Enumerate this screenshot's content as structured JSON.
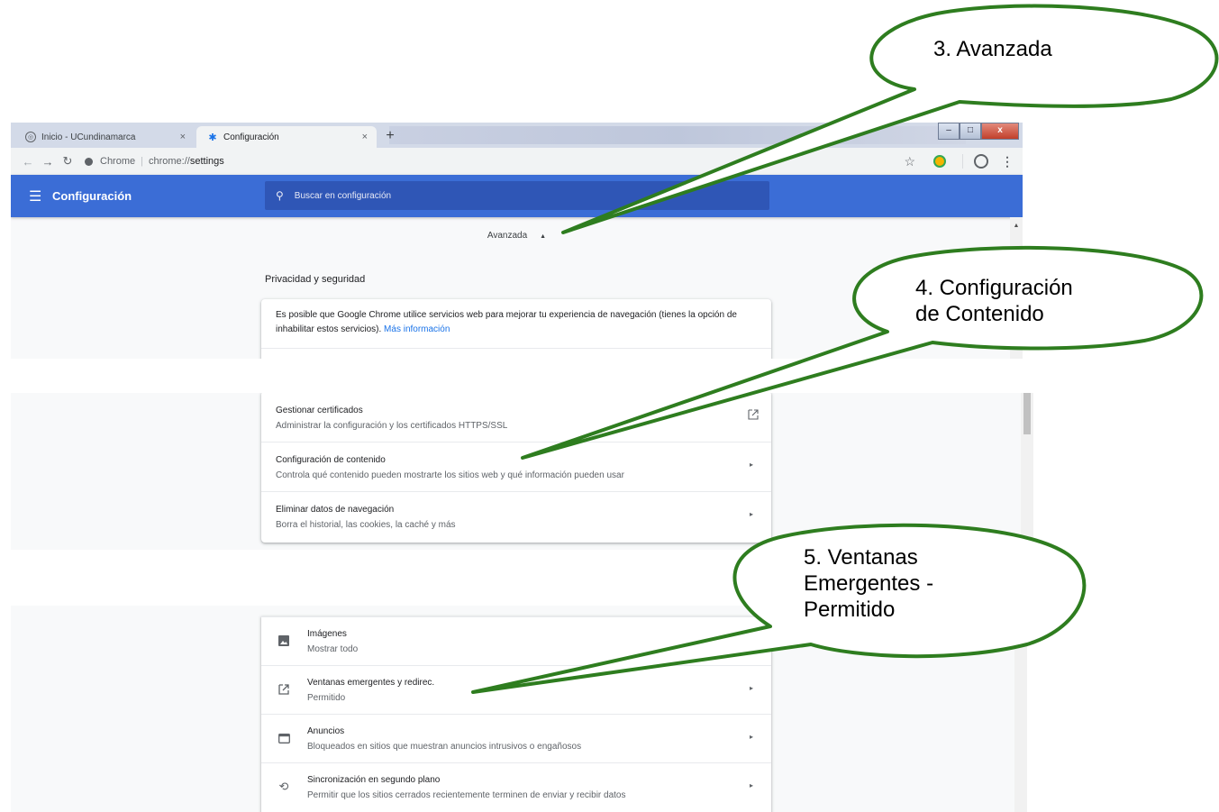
{
  "browser": {
    "tabs": [
      {
        "label": "Inicio - UCundinamarca",
        "close": "×"
      },
      {
        "label": "Configuración",
        "close": "×"
      }
    ],
    "new_tab": "+",
    "window_controls": {
      "minimize": "–",
      "maximize": "□",
      "close": "x"
    },
    "omnibox": {
      "site": "Chrome",
      "separator": "|",
      "url_scheme": "chrome://",
      "url_path": "settings"
    }
  },
  "header": {
    "title": "Configuración",
    "search_placeholder": "Buscar en configuración"
  },
  "advanced": {
    "label": "Avanzada"
  },
  "privacy": {
    "section_title": "Privacidad y seguridad",
    "intro_text": "Es posible que Google Chrome utilice servicios web para mejorar tu experiencia de navegación (tienes la opción de inhabilitar estos servicios).",
    "intro_link": "Más información"
  },
  "security_rows": [
    {
      "title": "Gestionar certificados",
      "subtitle": "Administrar la configuración y los certificados HTTPS/SSL"
    },
    {
      "title": "Configuración de contenido",
      "subtitle": "Controla qué contenido pueden mostrarte los sitios web y qué información pueden usar"
    },
    {
      "title": "Eliminar datos de navegación",
      "subtitle": "Borra el historial, las cookies, la caché y más"
    }
  ],
  "content_rows": [
    {
      "title": "Imágenes",
      "subtitle": "Mostrar todo"
    },
    {
      "title": "Ventanas emergentes y redirec.",
      "subtitle": "Permitido"
    },
    {
      "title": "Anuncios",
      "subtitle": "Bloqueados en sitios que muestran anuncios intrusivos o engañosos"
    },
    {
      "title": "Sincronización en segundo plano",
      "subtitle": "Permitir que los sitios cerrados recientemente terminen de enviar y recibir datos"
    }
  ],
  "callouts": {
    "step3": "3.   Avanzada",
    "step4_line1": "4. Configuración",
    "step4_line2": "de Contenido",
    "step5_line1": "5. Ventanas",
    "step5_line2": "Emergentes -",
    "step5_line3": "Permitido"
  },
  "colors": {
    "header_blue": "#3b6dd6",
    "callout_green": "#2e7d1f",
    "link_blue": "#1a73e8"
  },
  "icons": [
    "settings-icon",
    "search-icon",
    "menu-icon",
    "star-icon",
    "profile-icon",
    "more-vert-icon",
    "open-in-new-icon",
    "image-icon",
    "popup-icon",
    "ads-icon",
    "sync-icon",
    "chevron-right-icon"
  ]
}
